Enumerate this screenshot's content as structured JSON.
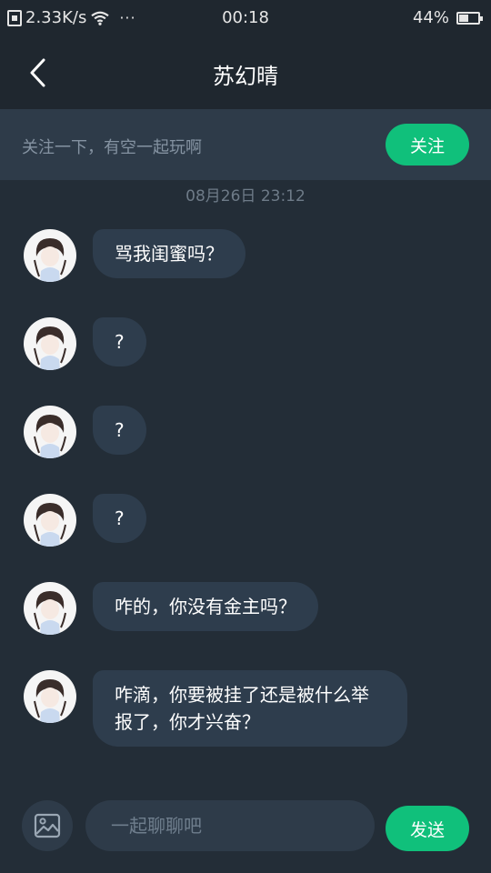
{
  "status_bar": {
    "speed": "2.33K/s",
    "dots": "···",
    "time": "00:18",
    "battery": "44%",
    "battery_level": 0.44
  },
  "header": {
    "title": "苏幻晴"
  },
  "follow_banner": {
    "text": "关注一下，有空一起玩啊",
    "button_label": "关注"
  },
  "timestamp": "08月26日 23:12",
  "messages": [
    {
      "text": "骂我闺蜜吗？"
    },
    {
      "text": "?"
    },
    {
      "text": "?"
    },
    {
      "text": "?"
    },
    {
      "text": "咋的，你没有金主吗？"
    },
    {
      "text": "咋滴，你要被挂了还是被什么举报了，你才兴奋？"
    }
  ],
  "input_bar": {
    "placeholder": "一起聊聊吧",
    "send_label": "发送"
  },
  "colors": {
    "accent": "#10c07b",
    "background": "#232d37",
    "bubble": "#2e3d4d"
  }
}
